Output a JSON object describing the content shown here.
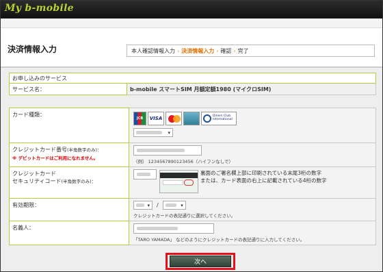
{
  "header": {
    "logo": "My b-mobile",
    "page_title": "決済情報入力"
  },
  "steps": {
    "items": [
      "本人確認情報入力",
      "決済情報入力",
      "確認",
      "完了"
    ],
    "current_index": 1,
    "separator": "›"
  },
  "service": {
    "section_title": "お申し込みのサービス",
    "name_label": "サービス名：",
    "name_value": "b-mobile スマートSIM 月額定額1980 (マイクロSIM)"
  },
  "form": {
    "card_type": {
      "label": "カード種類：",
      "brands": [
        "JCB",
        "VISA",
        "MasterCard",
        "AMERICAN EXPRESS",
        "Diners Club International"
      ]
    },
    "card_number": {
      "label": "クレジットカード番号",
      "label_note": "(半角数字のみ)：",
      "warning": "※ デビットカードはご利用になれません。",
      "example": "（例） 1234567890123456（ハイフンなしで）"
    },
    "security_code": {
      "label_line1": "クレジットカード",
      "label_line2": "セキュリティコード",
      "label_note": "(半角数字のみ)：",
      "help_line1": "裏面のご署名欄上部に印刷されている末尾3桁の数字",
      "help_line2": "または、カード表面の右上に記載されている4桁の数字"
    },
    "expiry": {
      "label": "有効期限：",
      "separator": "/",
      "note": "クレジットカードの表記通りに選択してください。"
    },
    "holder": {
      "label": "名義人：",
      "note": "「TARO YAMADA」 などのようにクレジットカードの表記通りに入力してください。"
    }
  },
  "submit": {
    "label": "次へ"
  },
  "colors": {
    "accent_green": "#b5cc3a",
    "step_current": "#e07000",
    "highlight_red": "#e4101a",
    "button_bg": "#3e5247"
  }
}
